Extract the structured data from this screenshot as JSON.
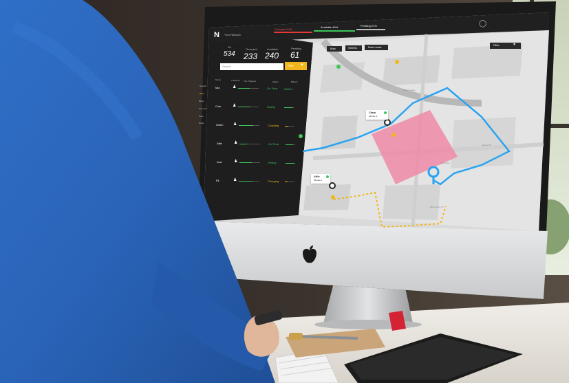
{
  "app": {
    "org_selector": "Your Network",
    "status_bar": {
      "occupied_label": "Occupied 64%",
      "available_label": "Available 46%",
      "pending_label": "Pending 21%"
    }
  },
  "stats": {
    "total_label": "All",
    "total_value": "534",
    "occupied_label": "Occupied",
    "occupied_value": "233",
    "available_label": "Available",
    "available_value": "240",
    "pending_label": "Pending",
    "pending_value": "61"
  },
  "search": {
    "placeholder": "Search"
  },
  "filter_button": {
    "label": "Filter"
  },
  "table": {
    "headers": [
      "Name",
      "Transport",
      "Trip Progress",
      "Status",
      "Battery"
    ],
    "rows": [
      {
        "name": "Mia",
        "progress_pct": 0.55,
        "status": "On Time",
        "status_color": "#3fc65a",
        "battery_pct": 0.7
      },
      {
        "name": "Cole",
        "progress_pct": 0.6,
        "status": "Ready",
        "status_color": "#3fc65a",
        "battery_pct": 0.85
      },
      {
        "name": "Gwen",
        "progress_pct": 0.7,
        "status": "Charging",
        "status_color": "#f2b61c",
        "battery_pct": 0.35
      },
      {
        "name": "Alfie",
        "progress_pct": 0.35,
        "status": "On Time",
        "status_color": "#3fc65a",
        "battery_pct": 0.8
      },
      {
        "name": "Ana",
        "progress_pct": 0.6,
        "status": "Ready",
        "status_color": "#3fc65a",
        "battery_pct": 0.9
      },
      {
        "name": "Eli",
        "progress_pct": 0.65,
        "status": "Charging",
        "status_color": "#f2b61c",
        "battery_pct": 0.3
      }
    ]
  },
  "side_nav": [
    "Scooter",
    "Bikes",
    "Bikes",
    "Scooters",
    "Cars",
    "Rides"
  ],
  "map": {
    "toolbar": {
      "map_label": "Map",
      "streets_label": "Streets",
      "dark_label": "Dark mode"
    },
    "filter_label": "Filter",
    "markers": [
      {
        "name": "Clara",
        "subtitle": "Minute to"
      },
      {
        "name": "Alfie",
        "subtitle": "Minute to"
      }
    ],
    "street_labels": [
      "Ashby Square",
      "Hollow Rd",
      "Oak Street",
      "Bloomsbury St."
    ]
  },
  "icons": {
    "logo": "N-logo-icon",
    "profile": "user-circle-icon",
    "filter_caret": "caret-down-icon",
    "apple_logo": "apple-logo-icon"
  },
  "colors": {
    "accent_amber": "#f2b61c",
    "status_green": "#3fc65a",
    "route_blue": "#2aa3f0",
    "zone_pink": "#f08aa8",
    "occupied_red": "#e53935"
  }
}
